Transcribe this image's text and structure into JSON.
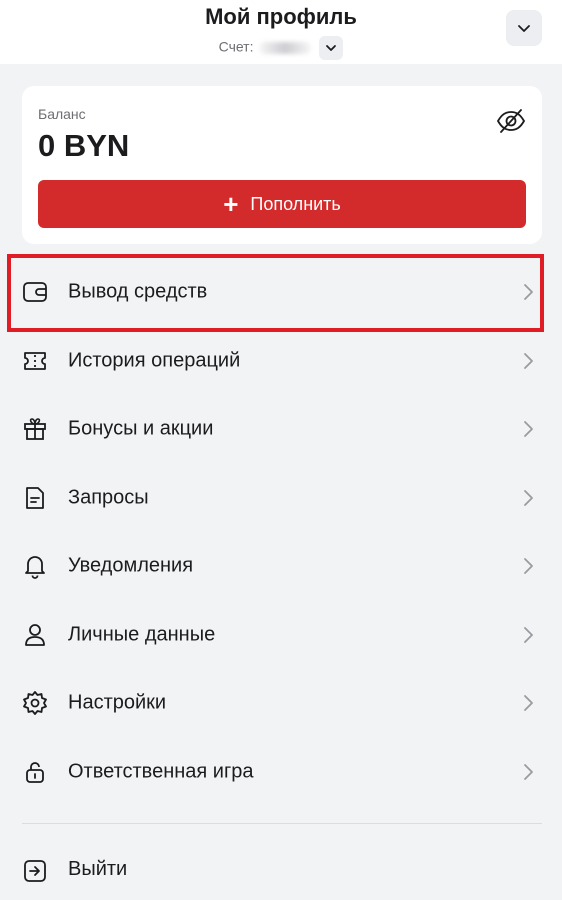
{
  "header": {
    "title": "Мой профиль",
    "subtitle": "Счет: ",
    "menu_icon": "chevron-down-icon"
  },
  "balance": {
    "label": "Баланс",
    "value": "0 BYN",
    "visibility_icon": "eye-off-icon",
    "topup_label": "Пополнить",
    "topup_color": "#d32b2b"
  },
  "menu": {
    "items": [
      {
        "label": "Вывод средств",
        "icon": "wallet-icon"
      },
      {
        "label": "История операций",
        "icon": "ticket-icon"
      },
      {
        "label": "Бонусы и акции",
        "icon": "gift-icon"
      },
      {
        "label": "Запросы",
        "icon": "document-icon"
      },
      {
        "label": "Уведомления",
        "icon": "bell-icon"
      },
      {
        "label": "Личные данные",
        "icon": "user-icon"
      },
      {
        "label": "Настройки",
        "icon": "gear-icon"
      },
      {
        "label": "Ответственная игра",
        "icon": "lock-icon"
      }
    ]
  },
  "logout": {
    "label": "Выйти",
    "icon": "logout-icon"
  },
  "highlight_color": "#e01c24"
}
